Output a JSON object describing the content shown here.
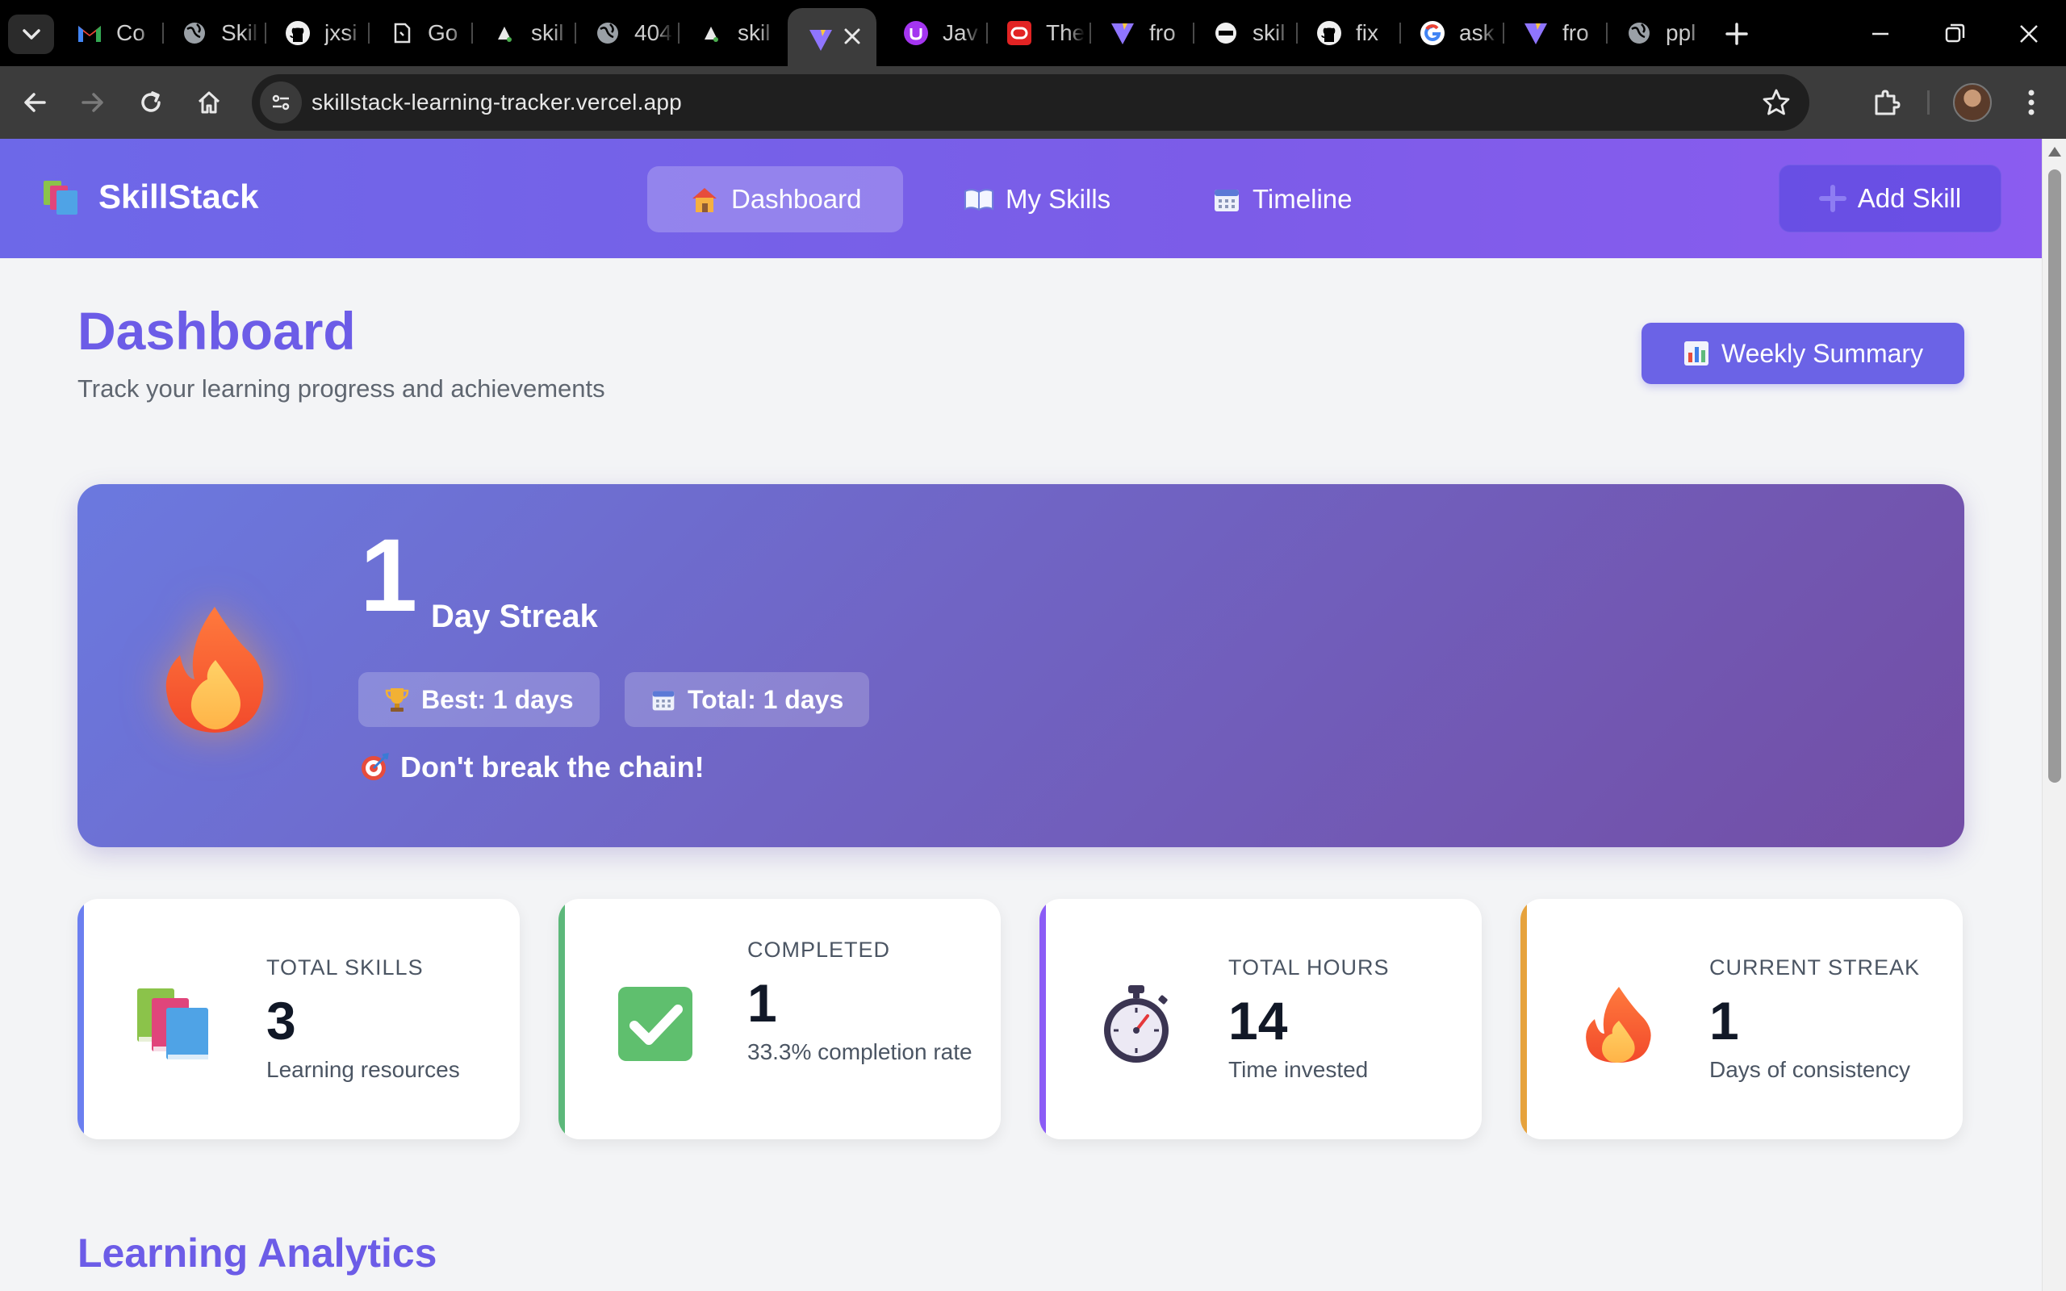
{
  "browser": {
    "tabs": [
      {
        "title": "Co",
        "icon": "gmail-icon"
      },
      {
        "title": "Skil",
        "icon": "globe-icon"
      },
      {
        "title": "jxsi",
        "icon": "github-icon"
      },
      {
        "title": "Go",
        "icon": "page-icon"
      },
      {
        "title": "skil",
        "icon": "triangle-icon"
      },
      {
        "title": "404",
        "icon": "globe-icon"
      },
      {
        "title": "skil",
        "icon": "triangle-icon"
      },
      {
        "title": "",
        "icon": "vite-icon",
        "active": true
      },
      {
        "title": "Jav",
        "icon": "udemy-icon"
      },
      {
        "title": "The",
        "icon": "oracle-icon"
      },
      {
        "title": "fro",
        "icon": "vite-icon"
      },
      {
        "title": "skil",
        "icon": "render-icon"
      },
      {
        "title": "fix",
        "icon": "github-icon"
      },
      {
        "title": "ask",
        "icon": "google-icon"
      },
      {
        "title": "fro",
        "icon": "vite-icon"
      },
      {
        "title": "ppl",
        "icon": "globe-icon"
      }
    ],
    "url": "skillstack-learning-tracker.vercel.app"
  },
  "app": {
    "brand": "SkillStack",
    "nav": {
      "dashboard": "Dashboard",
      "my_skills": "My Skills",
      "timeline": "Timeline"
    },
    "add_skill": "Add Skill",
    "page_title": "Dashboard",
    "page_subtitle": "Track your learning progress and achievements",
    "weekly_summary": "Weekly Summary",
    "streak": {
      "count": "1",
      "label": "Day Streak",
      "best": "Best: 1 days",
      "total": "Total: 1 days",
      "motto": "Don't break the chain!"
    },
    "stats": [
      {
        "label": "TOTAL SKILLS",
        "value": "3",
        "desc": "Learning resources",
        "accent": "#6b7ff0",
        "icon": "books-icon"
      },
      {
        "label": "COMPLETED",
        "value": "1",
        "desc": "33.3% completion rate",
        "accent": "#5cb87a",
        "icon": "check-icon"
      },
      {
        "label": "TOTAL HOURS",
        "value": "14",
        "desc": "Time invested",
        "accent": "#8b5cf6",
        "icon": "stopwatch-icon"
      },
      {
        "label": "CURRENT STREAK",
        "value": "1",
        "desc": "Days of consistency",
        "accent": "#e6a23c",
        "icon": "fire-icon"
      }
    ],
    "analytics_title": "Learning Analytics"
  }
}
